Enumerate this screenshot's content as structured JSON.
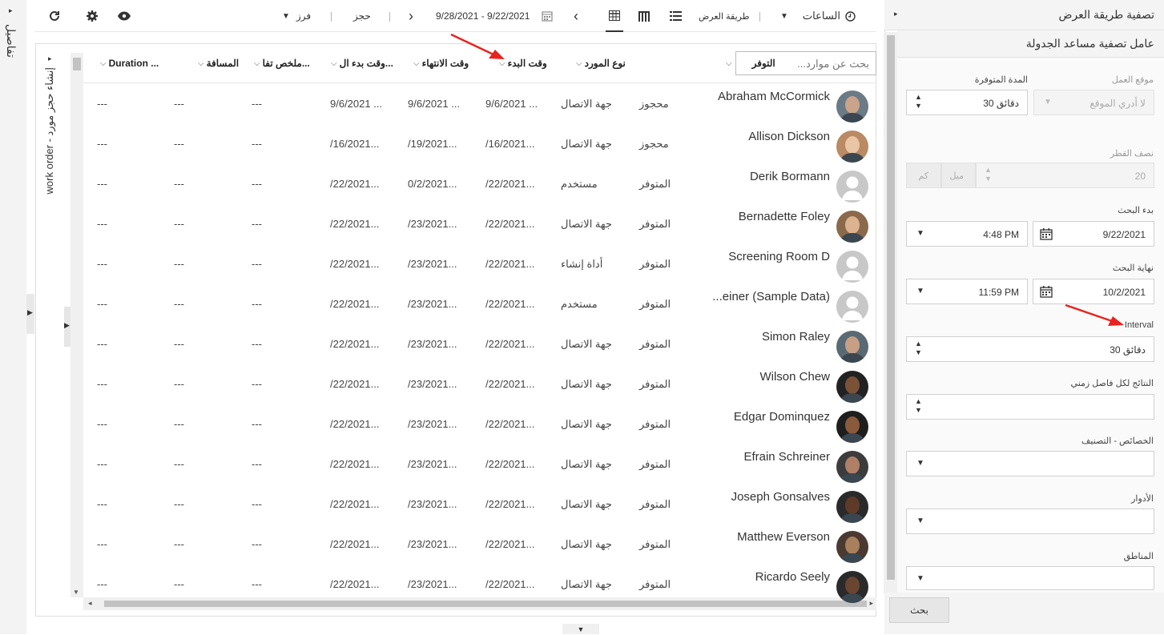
{
  "details_label": "تفاصيل",
  "toolbar": {
    "hours_label": "الساعات",
    "view_mode_label": "طريقة العرض",
    "date_range": "9/28/2021 - 9/22/2021",
    "book_label": "حجز",
    "sort_label": "فرز"
  },
  "side_panel_title": "work order - إنشاء حجز مورد",
  "grid": {
    "search_placeholder": "بحث عن موارد...",
    "headers": {
      "availability": "التوفر",
      "resource_type": "نوع المورد",
      "start_time": "وقت البدء",
      "end_time": "وقت الانتهاء",
      "travel_start": "وقت بدء ال...",
      "summary": "ملخص تفا...",
      "distance": "المسافة",
      "duration": "Duration ..."
    },
    "rows": [
      {
        "name": "Abraham McCormick",
        "avail": "محجوز",
        "type": "جهة الاتصال",
        "start": "9/6/2021 ...",
        "end": "9/6/2021 ...",
        "travel": "9/6/2021 ...",
        "summary": "---",
        "distance": "---",
        "duration": "---"
      },
      {
        "name": "Allison Dickson",
        "avail": "محجوز",
        "type": "جهة الاتصال",
        "start": "/16/2021...",
        "end": "/19/2021...",
        "travel": "/16/2021...",
        "summary": "---",
        "distance": "---",
        "duration": "---"
      },
      {
        "name": "Derik Bormann",
        "avail": "المتوفر",
        "type": "مستخدم",
        "start": "/22/2021...",
        "end": "0/2/2021...",
        "travel": "/22/2021...",
        "summary": "---",
        "distance": "---",
        "duration": "---"
      },
      {
        "name": "Bernadette Foley",
        "avail": "المتوفر",
        "type": "جهة الاتصال",
        "start": "/22/2021...",
        "end": "/23/2021...",
        "travel": "/22/2021...",
        "summary": "---",
        "distance": "---",
        "duration": "---"
      },
      {
        "name": "Screening Room D",
        "avail": "المتوفر",
        "type": "أداة إنشاء",
        "start": "/22/2021...",
        "end": "/23/2021...",
        "travel": "/22/2021...",
        "summary": "---",
        "distance": "---",
        "duration": "---"
      },
      {
        "name": "...einer (Sample Data)",
        "avail": "المتوفر",
        "type": "مستخدم",
        "start": "/22/2021...",
        "end": "/23/2021...",
        "travel": "/22/2021...",
        "summary": "---",
        "distance": "---",
        "duration": "---"
      },
      {
        "name": "Simon Raley",
        "avail": "المتوفر",
        "type": "جهة الاتصال",
        "start": "/22/2021...",
        "end": "/23/2021...",
        "travel": "/22/2021...",
        "summary": "---",
        "distance": "---",
        "duration": "---"
      },
      {
        "name": "Wilson Chew",
        "avail": "المتوفر",
        "type": "جهة الاتصال",
        "start": "/22/2021...",
        "end": "/23/2021...",
        "travel": "/22/2021...",
        "summary": "---",
        "distance": "---",
        "duration": "---"
      },
      {
        "name": "Edgar Dominquez",
        "avail": "المتوفر",
        "type": "جهة الاتصال",
        "start": "/22/2021...",
        "end": "/23/2021...",
        "travel": "/22/2021...",
        "summary": "---",
        "distance": "---",
        "duration": "---"
      },
      {
        "name": "Efrain Schreiner",
        "avail": "المتوفر",
        "type": "جهة الاتصال",
        "start": "/22/2021...",
        "end": "/23/2021...",
        "travel": "/22/2021...",
        "summary": "---",
        "distance": "---",
        "duration": "---"
      },
      {
        "name": "Joseph Gonsalves",
        "avail": "المتوفر",
        "type": "جهة الاتصال",
        "start": "/22/2021...",
        "end": "/23/2021...",
        "travel": "/22/2021...",
        "summary": "---",
        "distance": "---",
        "duration": "---"
      },
      {
        "name": "Matthew Everson",
        "avail": "المتوفر",
        "type": "جهة الاتصال",
        "start": "/22/2021...",
        "end": "/23/2021...",
        "travel": "/22/2021...",
        "summary": "---",
        "distance": "---",
        "duration": "---"
      },
      {
        "name": "Ricardo Seely",
        "avail": "المتوفر",
        "type": "جهة الاتصال",
        "start": "/22/2021...",
        "end": "/23/2021...",
        "travel": "/22/2021...",
        "summary": "---",
        "distance": "---",
        "duration": "---"
      }
    ]
  },
  "filter": {
    "title": "تصفية طريقة العرض",
    "subtitle": "عامل تصفية مساعد الجدولة",
    "work_location_label": "موقع العمل",
    "work_location_value": "لا أدري الموقع",
    "available_duration_label": "المدة المتوفرة",
    "available_duration_value": "30 دقائق",
    "radius_label": "نصف القطر",
    "radius_value": "20",
    "radius_unit_mile": "ميل",
    "radius_unit_km": "كم",
    "search_start_label": "بدء البحث",
    "search_start_date": "9/22/2021",
    "search_start_time": "4:48 PM",
    "search_end_label": "نهاية البحث",
    "search_end_date": "10/2/2021",
    "search_end_time": "11:59 PM",
    "interval_label": "Interval",
    "interval_value": "30 دقائق",
    "results_per_slot_label": "النتائج لكل فاصل زمني",
    "characteristics_label": "الخصائص - التصنيف",
    "roles_label": "الأدوار",
    "territories_label": "المناطق",
    "search_button": "بحث"
  },
  "colors": {
    "annotation_arrow": "#e8231f",
    "accent": "#333333"
  }
}
